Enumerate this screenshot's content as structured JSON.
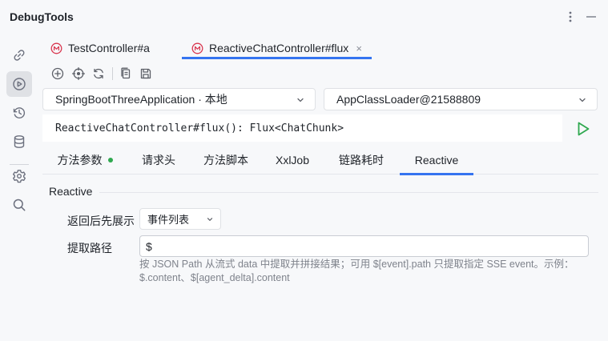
{
  "app": {
    "title": "DebugTools"
  },
  "header": {
    "more_icon": "kebab-vertical-icon",
    "minimize_icon": "minimize-icon"
  },
  "sidebar": {
    "items": [
      {
        "icon": "link-icon",
        "active": false
      },
      {
        "icon": "play-circle-icon",
        "active": true
      },
      {
        "icon": "history-icon",
        "active": false
      },
      {
        "icon": "database-icon",
        "active": false
      },
      {
        "icon": "gear-icon",
        "active": false
      },
      {
        "icon": "search-icon",
        "active": false
      }
    ]
  },
  "file_tabs": [
    {
      "label": "TestController#a",
      "icon": "m-icon",
      "active": false
    },
    {
      "label": "ReactiveChatController#flux",
      "icon": "m-icon",
      "active": true,
      "close": "×"
    }
  ],
  "toolbar": {
    "icons": [
      "add-circle-icon",
      "target-icon",
      "refresh-icon",
      "copy-icon",
      "save-icon"
    ]
  },
  "selects": {
    "application": "SpringBootThreeApplication · 本地",
    "classloader": "AppClassLoader@21588809"
  },
  "signature": "ReactiveChatController#flux(): Flux<ChatChunk>",
  "sub_tabs": [
    {
      "label": "方法参数",
      "dot": true,
      "active": false
    },
    {
      "label": "请求头",
      "active": false
    },
    {
      "label": "方法脚本",
      "active": false
    },
    {
      "label": "XxlJob",
      "active": false
    },
    {
      "label": "链路耗时",
      "active": false
    },
    {
      "label": "Reactive",
      "active": true
    }
  ],
  "reactive": {
    "section_title": "Reactive",
    "display_label": "返回后先展示",
    "display_value": "事件列表",
    "path_label": "提取路径",
    "path_value": "$",
    "hint": "按 JSON Path 从流式 data 中提取并拼接结果；可用 $[event].path 只提取指定 SSE event。示例：$.content、$[agent_delta].content"
  },
  "colors": {
    "accent": "#3574f0",
    "run": "#2fa84f",
    "method_icon": "#d9364f"
  }
}
